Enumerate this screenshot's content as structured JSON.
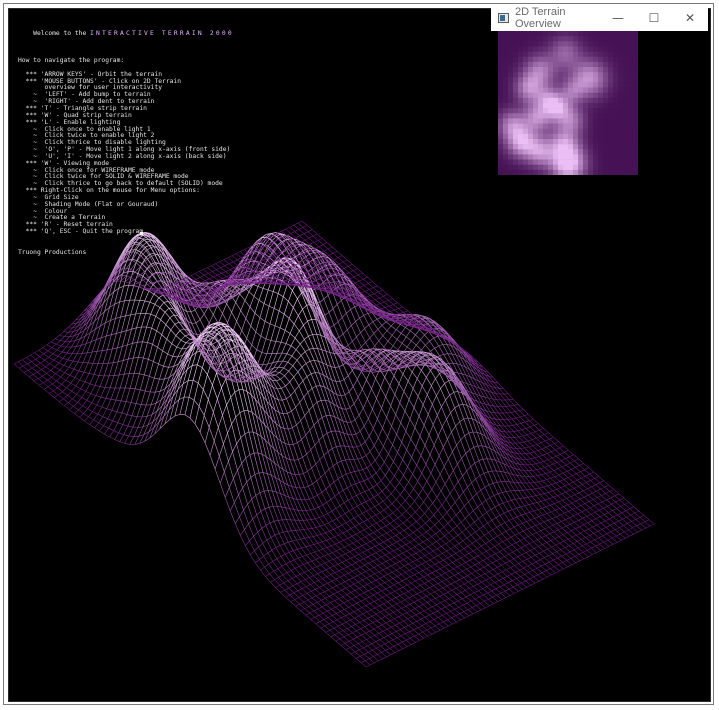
{
  "help": {
    "welcome_prefix": "    Welcome to the ",
    "welcome_title": "INTERACTIVE TERRAIN 2000",
    "lines": [
      "",
      "How to navigate the program:",
      "",
      "  *** 'ARROW KEYS' - Orbit the terrain",
      "  *** 'MOUSE BUTTONS' - Click on 2D Terrain",
      "       overview for user interactivity",
      "    ~  'LEFT' - Add bump to terrain",
      "    ~  'RIGHT' - Add dent to terrain",
      "  *** 'T' - Triangle strip terrain",
      "  *** 'W' - Quad strip terrain",
      "  *** 'L' - Enable lighting",
      "    ~  Click once to enable light 1",
      "    ~  Click twice to enable light 2",
      "    ~  Click thrice to disable lighting",
      "    ~  'O', 'P' - Move light 1 along x-axis (front side)",
      "    ~  'U', 'I' - Move light 2 along x-axis (back side)",
      "  *** 'W' - Viewing mode",
      "    ~  Click once for WIREFRAME mode",
      "    ~  Click twice for SOLID & WIREFRAME mode",
      "    ~  Click thrice to go back to default (SOLID) mode",
      "  *** Right-Click on the mouse for Menu options:",
      "    ~  Grid Size",
      "    ~  Shading Mode (Flat or Gouraud)",
      "    ~  Colour",
      "    ~  Create a Terrain",
      "  *** 'R' - Reset terrain",
      "  *** 'Q', ESC - Quit the program",
      "",
      "",
      "Truong Productions"
    ]
  },
  "overview_window": {
    "title": "2D Terrain Overview",
    "minimize_icon": "—",
    "maximize_icon": "☐",
    "close_icon": "✕"
  },
  "colors": {
    "background": "#000000",
    "wire": "#b040c8",
    "wire_highlight": "#f4d6ff",
    "overview_base": "#5a1a66"
  }
}
